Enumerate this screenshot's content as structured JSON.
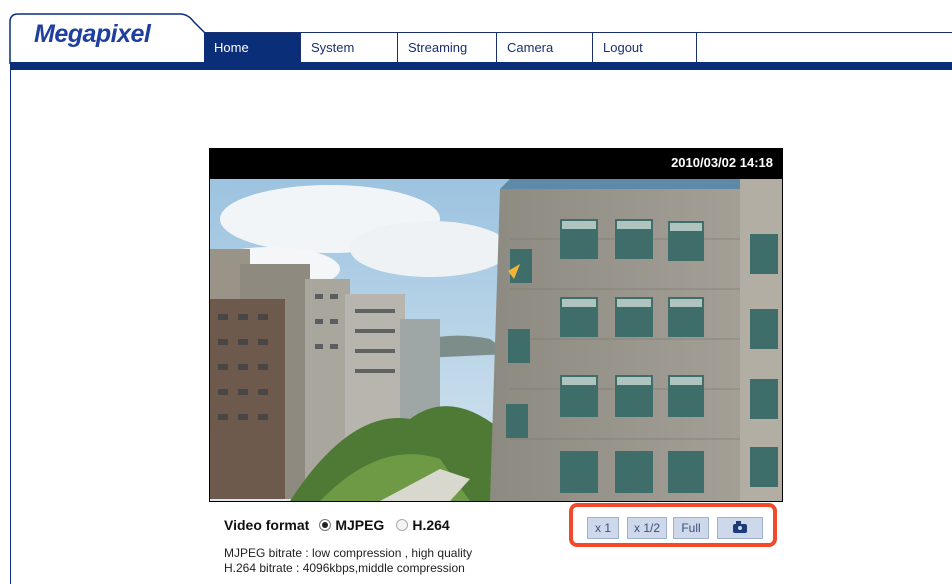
{
  "brand": {
    "logo_text": "Megapixel"
  },
  "nav": {
    "items": [
      {
        "label": "Home",
        "active": true
      },
      {
        "label": "System",
        "active": false
      },
      {
        "label": "Streaming",
        "active": false
      },
      {
        "label": "Camera",
        "active": false
      },
      {
        "label": "Logout",
        "active": false
      }
    ]
  },
  "viewer": {
    "timestamp": "2010/03/02 14:18"
  },
  "video_format": {
    "label": "Video format",
    "options": [
      {
        "label": "MJPEG",
        "selected": true
      },
      {
        "label": "H.264",
        "selected": false
      }
    ]
  },
  "bitrate_info": {
    "mjpeg": "MJPEG bitrate : low compression , high quality",
    "h264": "H.264 bitrate : 4096kbps,middle compression"
  },
  "zoom_controls": {
    "x1": "x 1",
    "half": "x 1/2",
    "full": "Full",
    "snapshot_icon": "camera-icon"
  },
  "colors": {
    "nav_blue": "#0b2e78",
    "highlight": "#f04a2a",
    "button_bg": "#cdd9ea"
  }
}
